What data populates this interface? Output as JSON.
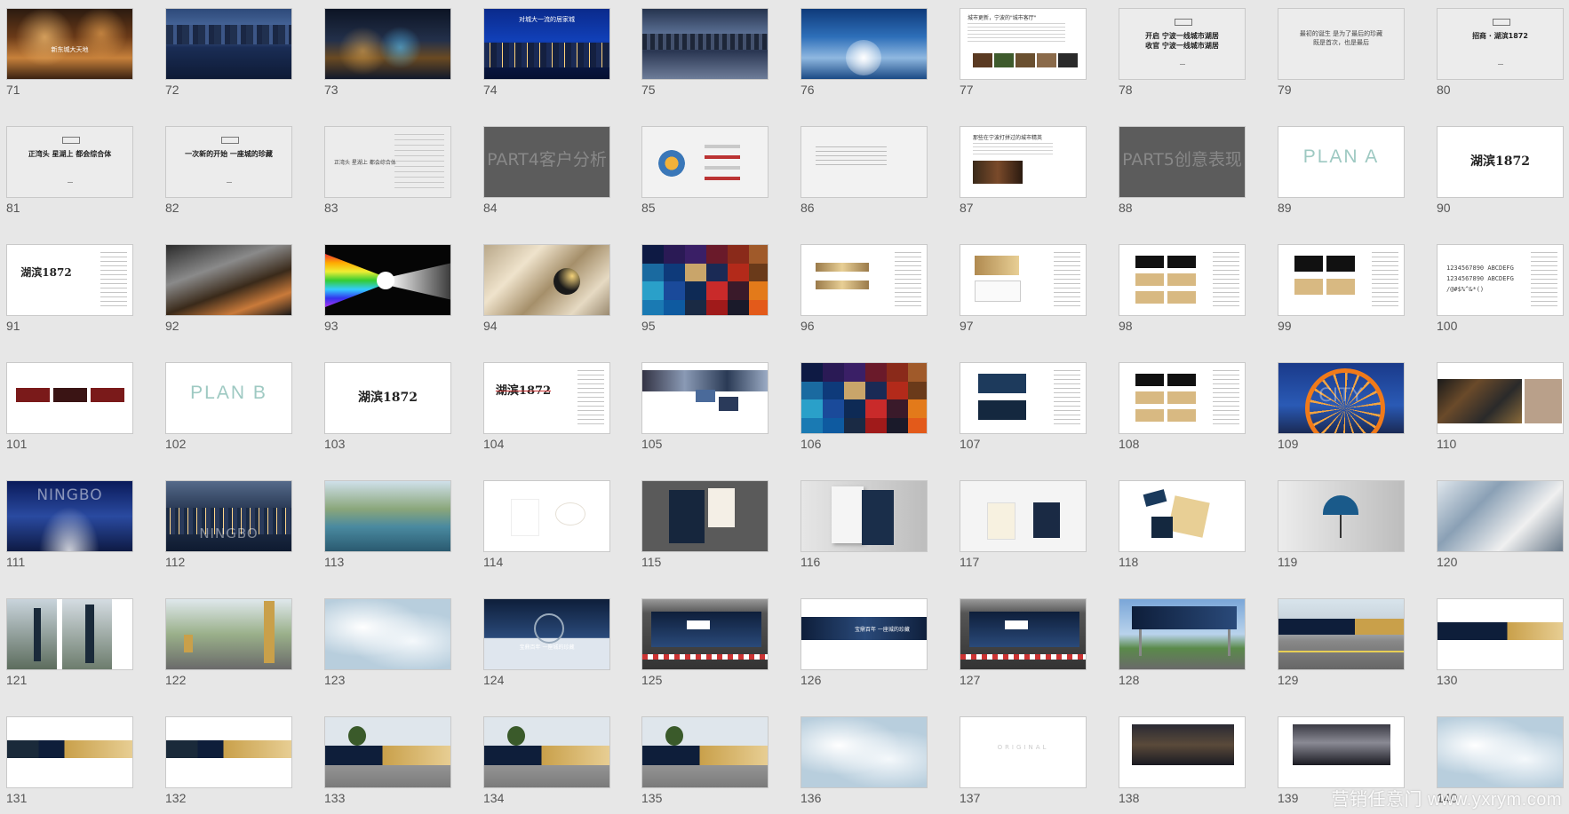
{
  "columns": 10,
  "watermark": "营销任意门 www.yxrym.com",
  "slides": [
    {
      "num": "71",
      "style": "photo-street",
      "text": [
        "新东城大天地"
      ]
    },
    {
      "num": "72",
      "style": "photo-river",
      "text": []
    },
    {
      "num": "73",
      "style": "photo-night",
      "text": []
    },
    {
      "num": "74",
      "style": "photo-blue-city",
      "text": [
        "对城大一流的居家城"
      ]
    },
    {
      "num": "75",
      "style": "photo-dusk",
      "text": []
    },
    {
      "num": "76",
      "style": "photo-fountain",
      "text": []
    },
    {
      "num": "77",
      "style": "text-photos",
      "text": [
        "城市更新，宁波的\"城市客厅\""
      ]
    },
    {
      "num": "78",
      "style": "title",
      "text": [
        "开启 宁波一线城市湖居",
        "收官 宁波一线城市湖居"
      ]
    },
    {
      "num": "79",
      "style": "title-light",
      "text": [
        "最初的诞生 是为了最后的珍藏",
        "既是首次，也是最后"
      ]
    },
    {
      "num": "80",
      "style": "title",
      "text": [
        "招商 · 湖滨1872"
      ]
    },
    {
      "num": "81",
      "style": "title",
      "text": [
        "正湾头  星湖上  都会综合体"
      ]
    },
    {
      "num": "82",
      "style": "title",
      "text": [
        "一次新的开始  一座城的珍藏"
      ]
    },
    {
      "num": "83",
      "style": "title-list",
      "text": [
        "正湾头  星湖上  都会综合体"
      ]
    },
    {
      "num": "84",
      "style": "section-dark",
      "text": [
        "PART4客户分析"
      ]
    },
    {
      "num": "85",
      "style": "diagram",
      "text": []
    },
    {
      "num": "86",
      "style": "text-light",
      "text": []
    },
    {
      "num": "87",
      "style": "text-photo",
      "text": [
        "那些在宁波打拼过的城市精英"
      ]
    },
    {
      "num": "88",
      "style": "section-dark",
      "text": [
        "PART5创意表现"
      ]
    },
    {
      "num": "89",
      "style": "plan-a",
      "text": [
        "PLAN A"
      ]
    },
    {
      "num": "90",
      "style": "logo-white",
      "text": [
        "湖滨1872"
      ]
    },
    {
      "num": "91",
      "style": "logo-text",
      "text": [
        "湖滨1872"
      ]
    },
    {
      "num": "92",
      "style": "photo-arch",
      "text": []
    },
    {
      "num": "93",
      "style": "prism",
      "text": []
    },
    {
      "num": "94",
      "style": "gold-sphere",
      "text": []
    },
    {
      "num": "95",
      "style": "mosaic",
      "text": []
    },
    {
      "num": "96",
      "style": "gold-bars",
      "text": []
    },
    {
      "num": "97",
      "style": "gold-cards",
      "text": []
    },
    {
      "num": "98",
      "style": "logo-grid",
      "text": []
    },
    {
      "num": "99",
      "style": "logo-grid2",
      "text": []
    },
    {
      "num": "100",
      "style": "font-sample",
      "text": [
        "1234567890 ABCDEFG",
        "1234567890 ABCDEFG",
        "/@#$%^&*()"
      ]
    },
    {
      "num": "101",
      "style": "red-logos",
      "text": []
    },
    {
      "num": "102",
      "style": "plan-b",
      "text": [
        "PLAN B"
      ]
    },
    {
      "num": "103",
      "style": "logo-white",
      "text": [
        "湖滨1872"
      ]
    },
    {
      "num": "104",
      "style": "logo-text-red",
      "text": [
        "湖滨1872"
      ]
    },
    {
      "num": "105",
      "style": "collage",
      "text": []
    },
    {
      "num": "106",
      "style": "mosaic",
      "text": []
    },
    {
      "num": "107",
      "style": "navy-cards",
      "text": []
    },
    {
      "num": "108",
      "style": "logo-grid",
      "text": []
    },
    {
      "num": "109",
      "style": "ferris",
      "text": [
        "CITY"
      ]
    },
    {
      "num": "110",
      "style": "map",
      "text": []
    },
    {
      "num": "111",
      "style": "ningbo",
      "text": [
        "NINGBO"
      ]
    },
    {
      "num": "112",
      "style": "photo-aerial",
      "text": [
        "NINGBO"
      ]
    },
    {
      "num": "113",
      "style": "photo-aerial2",
      "text": []
    },
    {
      "num": "114",
      "style": "faint",
      "text": []
    },
    {
      "num": "115",
      "style": "stationery",
      "text": []
    },
    {
      "num": "116",
      "style": "book",
      "text": []
    },
    {
      "num": "117",
      "style": "bags",
      "text": []
    },
    {
      "num": "118",
      "style": "items",
      "text": []
    },
    {
      "num": "119",
      "style": "umbrella",
      "text": []
    },
    {
      "num": "120",
      "style": "interior",
      "text": []
    },
    {
      "num": "121",
      "style": "signage",
      "text": []
    },
    {
      "num": "122",
      "style": "road-sign",
      "text": []
    },
    {
      "num": "123",
      "style": "cloud",
      "text": []
    },
    {
      "num": "124",
      "style": "billboard-clock",
      "text": [
        "宝鼎百年  一座城的珍藏"
      ]
    },
    {
      "num": "125",
      "style": "billboard-bldg",
      "text": []
    },
    {
      "num": "126",
      "style": "billboard-wide",
      "text": [
        "宝鼎百年  一座城的珍藏"
      ]
    },
    {
      "num": "127",
      "style": "billboard-bldg",
      "text": []
    },
    {
      "num": "128",
      "style": "billboard-sky",
      "text": []
    },
    {
      "num": "129",
      "style": "hoarding-road",
      "text": []
    },
    {
      "num": "130",
      "style": "hoarding-gold",
      "text": []
    },
    {
      "num": "131",
      "style": "banner",
      "text": []
    },
    {
      "num": "132",
      "style": "banner",
      "text": []
    },
    {
      "num": "133",
      "style": "hoarding-tree",
      "text": []
    },
    {
      "num": "134",
      "style": "hoarding-tree",
      "text": []
    },
    {
      "num": "135",
      "style": "hoarding-tree",
      "text": []
    },
    {
      "num": "136",
      "style": "cloud",
      "text": []
    },
    {
      "num": "137",
      "style": "original",
      "text": [
        "ORIGINAL"
      ]
    },
    {
      "num": "138",
      "style": "photo-night-small",
      "text": []
    },
    {
      "num": "139",
      "style": "photo-pier",
      "text": []
    },
    {
      "num": "140",
      "style": "cloud-small",
      "text": []
    }
  ]
}
